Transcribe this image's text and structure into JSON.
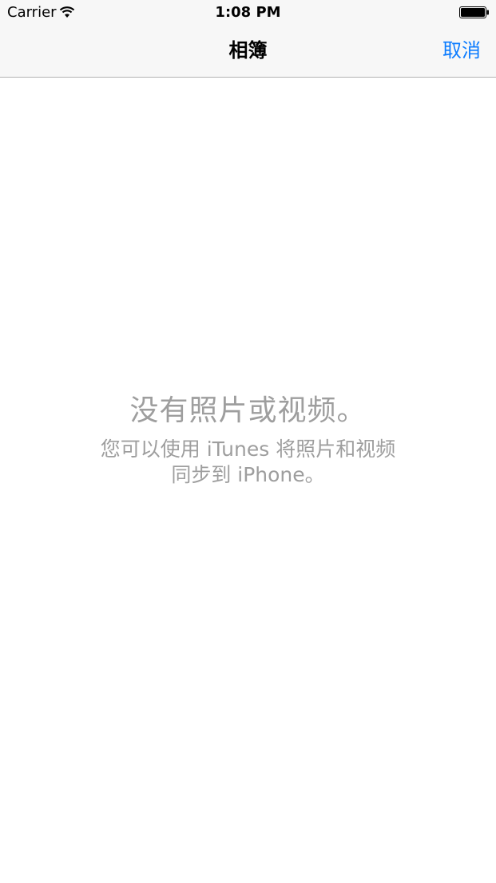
{
  "status_bar": {
    "carrier": "Carrier",
    "time": "1:08 PM",
    "icons": [
      "wifi-icon",
      "battery-icon"
    ]
  },
  "nav_bar": {
    "title": "相簿",
    "cancel_label": "取消"
  },
  "empty_state": {
    "title": "没有照片或视频。",
    "message_line1": "您可以使用 iTunes 将照片和视频",
    "message_line2": "同步到 iPhone。"
  },
  "colors": {
    "accent": "#0a7bff",
    "secondary_text": "#9e9e9e",
    "bar_background": "#f7f7f7",
    "separator": "#b2b2b2"
  }
}
